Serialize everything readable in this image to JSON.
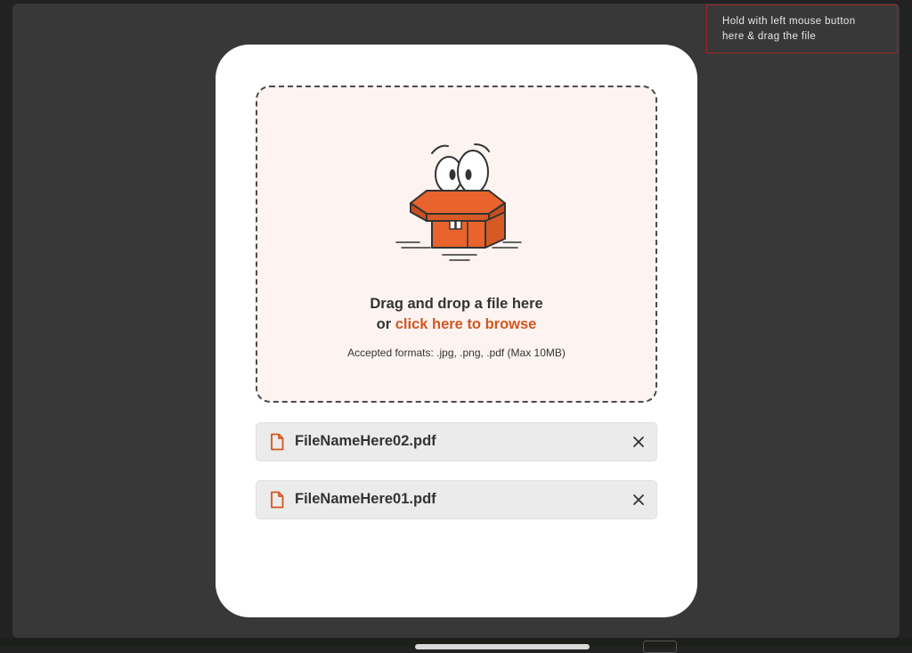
{
  "tooltip": {
    "line1": "Hold with left mouse button",
    "line2": "here & drag the file"
  },
  "dropzone": {
    "title": "Drag and drop a file here",
    "or_text": "or",
    "browse_label": "click here to browse",
    "formats_text": "Accepted formats: .jpg, .png, .pdf (Max 10MB)",
    "illustration": "surprised-box-mascot"
  },
  "files": [
    {
      "name": "FileNameHere02.pdf",
      "icon": "file-icon",
      "remove_icon": "close-icon"
    },
    {
      "name": "FileNameHere01.pdf",
      "icon": "file-icon",
      "remove_icon": "close-icon"
    }
  ],
  "colors": {
    "accent": "#d4561f",
    "box_orange": "#e8642c",
    "dropzone_bg": "#fdf4f1",
    "tooltip_border": "#a3222a",
    "backdrop": "#383838"
  }
}
